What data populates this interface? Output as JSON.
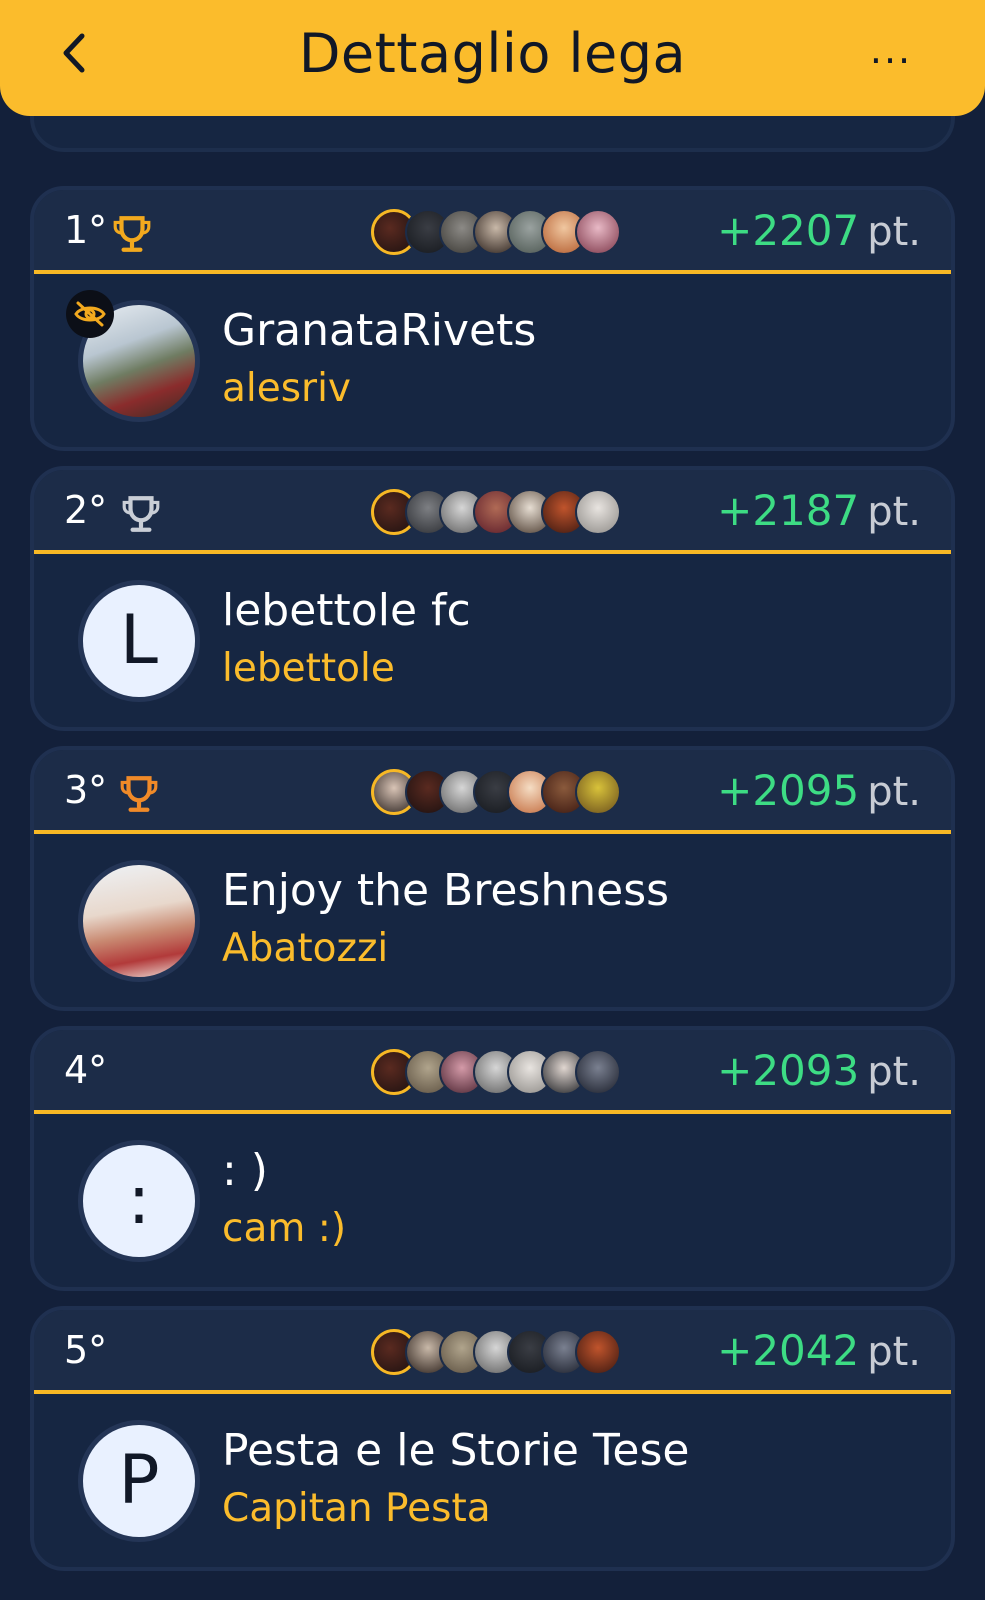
{
  "header": {
    "title": "Dettaglio lega",
    "more_label": "..."
  },
  "colors": {
    "header_bg": "#fbbc2c",
    "page_bg": "#13203a",
    "points_green": "#3ddc84",
    "owner_yellow": "#fbbc2c",
    "trophy_gold": "#f2a91e",
    "trophy_silver": "#c9ced6",
    "trophy_bronze": "#f08a28"
  },
  "icons": {
    "back": "chevron-left-icon",
    "more": "more-horizontal-icon",
    "trophy": "trophy-icon",
    "hidden": "eye-off-icon"
  },
  "standings": [
    {
      "rank": "1°",
      "trophy": "gold",
      "points": "+2207",
      "unit": "pt.",
      "team": "GranataRivets",
      "owner": "alesriv",
      "avatar_initial": "",
      "hidden_badge": true
    },
    {
      "rank": "2°",
      "trophy": "silver",
      "points": "+2187",
      "unit": "pt.",
      "team": "lebettole fc",
      "owner": "lebettole",
      "avatar_initial": "L",
      "hidden_badge": false
    },
    {
      "rank": "3°",
      "trophy": "bronze",
      "points": "+2095",
      "unit": "pt.",
      "team": "Enjoy the Breshness",
      "owner": "Abatozzi",
      "avatar_initial": "",
      "hidden_badge": false
    },
    {
      "rank": "4°",
      "trophy": "none",
      "points": "+2093",
      "unit": "pt.",
      "team": ": )",
      "owner": "cam :)",
      "avatar_initial": ":",
      "hidden_badge": false
    },
    {
      "rank": "5°",
      "trophy": "none",
      "points": "+2042",
      "unit": "pt.",
      "team": "Pesta e le Storie Tese",
      "owner": "Capitan Pesta",
      "avatar_initial": "P",
      "hidden_badge": false
    }
  ]
}
